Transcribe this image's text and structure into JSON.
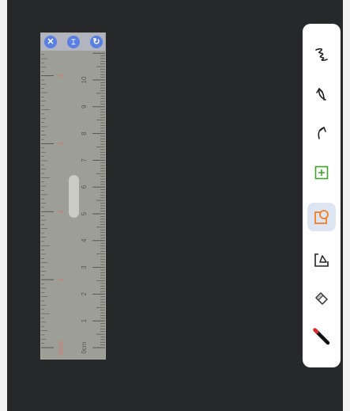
{
  "ruler": {
    "close_glyph": "✕",
    "middle_glyph": "⌶",
    "rotate_glyph": "↻",
    "cm_labels": [
      "0cm",
      "1",
      "2",
      "3",
      "4",
      "5",
      "6",
      "7",
      "8",
      "9",
      "10"
    ],
    "inch_labels": [
      "0inch",
      "1",
      "2",
      "3",
      "4"
    ],
    "colors": {
      "body": "#9d9f97",
      "inch_label": "#d2786a",
      "button": "#5a7fe3"
    }
  },
  "toolbar": {
    "tools": [
      {
        "name": "freehand-tool",
        "icon": "scribble-icon"
      },
      {
        "name": "undo-button",
        "icon": "undo-arrow-icon"
      },
      {
        "name": "redo-button",
        "icon": "redo-arrow-icon"
      },
      {
        "name": "add-box-button",
        "icon": "plus-box-icon"
      },
      {
        "name": "shape-tool",
        "icon": "shape-icon",
        "active": true
      },
      {
        "name": "lasso-select-tool",
        "icon": "lasso-icon"
      },
      {
        "name": "eraser-tool",
        "icon": "eraser-icon"
      },
      {
        "name": "pen-tool",
        "icon": "pen-icon"
      }
    ]
  }
}
